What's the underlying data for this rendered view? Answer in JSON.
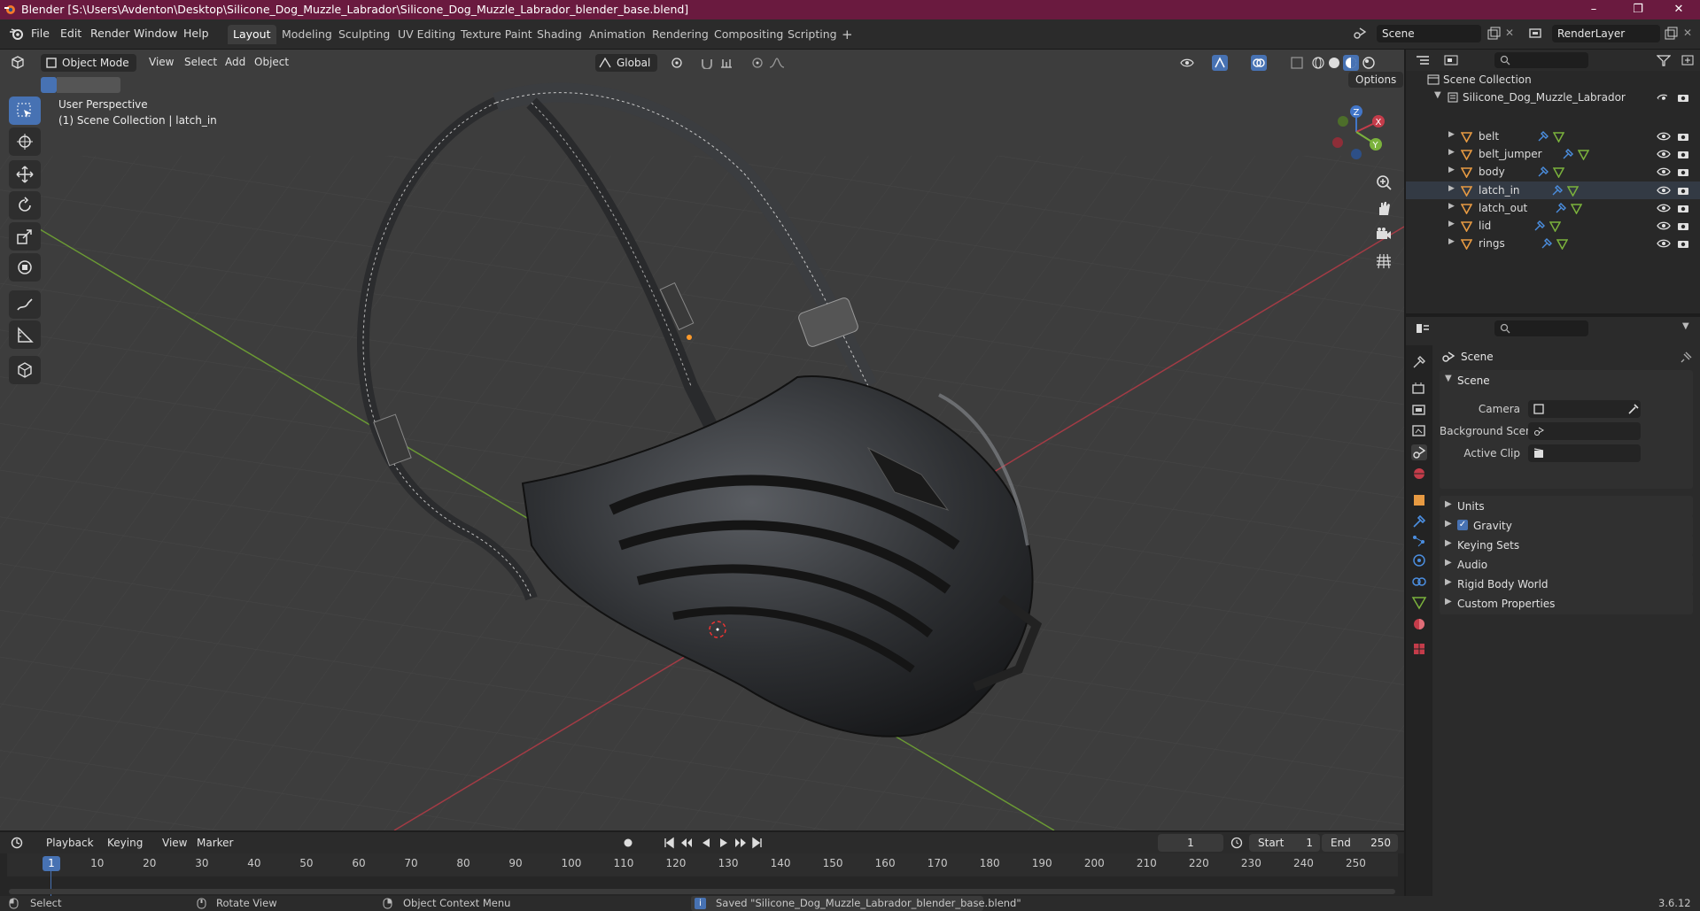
{
  "window": {
    "title": "Blender [S:\\Users\\Avdenton\\Desktop\\Silicone_Dog_Muzzle_Labrador\\Silicone_Dog_Muzzle_Labrador_blender_base.blend]",
    "minimize": "–",
    "maximize": "❐",
    "close": "✕"
  },
  "menus": [
    "File",
    "Edit",
    "Render",
    "Window",
    "Help"
  ],
  "workspaces": [
    "Layout",
    "Modeling",
    "Sculpting",
    "UV Editing",
    "Texture Paint",
    "Shading",
    "Animation",
    "Rendering",
    "Compositing",
    "Scripting"
  ],
  "add_workspace": "+",
  "scene_field": "Scene",
  "render_layer_field": "RenderLayer",
  "viewport": {
    "mode": "Object Mode",
    "menus": [
      "View",
      "Select",
      "Add",
      "Object"
    ],
    "transform_orientation": "Global",
    "options_label": "Options",
    "perspective_label": "User Perspective",
    "collection_label": "(1) Scene Collection | latch_in",
    "gizmo_axes": [
      "X",
      "Y",
      "Z"
    ]
  },
  "outliner": {
    "root": "Scene Collection",
    "collection": "Silicone_Dog_Muzzle_Labrador",
    "objects": [
      "belt",
      "belt_jumper",
      "body",
      "latch_in",
      "latch_out",
      "lid",
      "rings"
    ]
  },
  "properties": {
    "header": "Scene",
    "section": "Scene",
    "fields": [
      {
        "label": "Camera",
        "value": ""
      },
      {
        "label": "Background Scene",
        "value": ""
      },
      {
        "label": "Active Clip",
        "value": ""
      }
    ],
    "panels": [
      "Units",
      "Gravity",
      "Keying Sets",
      "Audio",
      "Rigid Body World",
      "Custom Properties"
    ],
    "gravity_checked": true
  },
  "timeline": {
    "menus": [
      "Playback",
      "Keying",
      "View",
      "Marker"
    ],
    "current_frame": "1",
    "start_label": "Start",
    "start_value": "1",
    "end_label": "End",
    "end_value": "250",
    "ticks": [
      "1",
      "10",
      "20",
      "30",
      "40",
      "50",
      "60",
      "70",
      "80",
      "90",
      "100",
      "110",
      "120",
      "130",
      "140",
      "150",
      "160",
      "170",
      "180",
      "190",
      "200",
      "210",
      "220",
      "230",
      "240",
      "250"
    ]
  },
  "status": {
    "select": "Select",
    "rotate": "Rotate View",
    "context": "Object Context Menu",
    "message": "Saved \"Silicone_Dog_Muzzle_Labrador_blender_base.blend\"",
    "version": "3.6.12"
  },
  "colors": {
    "titlebar": "#6a1a3f",
    "accent": "#4772b3",
    "x_axis": "#c43c4a",
    "y_axis": "#7bb23c",
    "z_axis": "#4276c9",
    "object_orange": "#e79a42"
  }
}
